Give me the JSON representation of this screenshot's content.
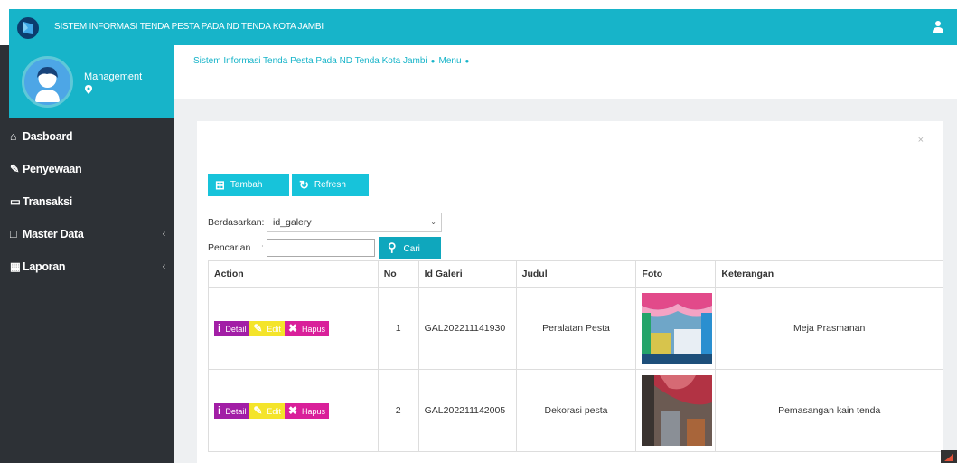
{
  "header": {
    "title": "SISTEM INFORMASI TENDA PESTA PADA ND TENDA KOTA JAMBI",
    "logo_icon": "logo-icon",
    "user_icon": "user-icon"
  },
  "profile": {
    "name": "Management"
  },
  "sidebar": {
    "items": [
      {
        "label": "Dasboard",
        "icon": "home-icon"
      },
      {
        "label": "Penyewaan",
        "icon": "pencil-icon"
      },
      {
        "label": "Transaksi",
        "icon": "book-icon"
      },
      {
        "label": "Master Data",
        "icon": "edit-icon",
        "has_children": true
      },
      {
        "label": "Laporan",
        "icon": "calendar-icon",
        "has_children": true
      }
    ]
  },
  "breadcrumb": {
    "path": "Sistem Informasi Tenda Pesta Pada ND Tenda Kota Jambi",
    "current": "Menu"
  },
  "toolbar": {
    "add_label": "Tambah",
    "refresh_label": "Refresh",
    "close_label": "×"
  },
  "filter": {
    "by_label": "Berdasarkan:",
    "by_value": "id_galery",
    "search_label": "Pencarian",
    "search_value": "",
    "search_button": "Cari"
  },
  "table": {
    "headers": [
      "Action",
      "No",
      "Id Galeri",
      "Judul",
      "Foto",
      "Keterangan"
    ],
    "action_labels": {
      "detail": "Detail",
      "edit": "Edit",
      "delete": "Hapus"
    },
    "rows": [
      {
        "no": "1",
        "id": "GAL202211141930",
        "judul": "Peralatan Pesta",
        "keterangan": "Meja Prasmanan"
      },
      {
        "no": "2",
        "id": "GAL202211142005",
        "judul": "Dekorasi pesta",
        "keterangan": "Pemasangan kain tenda"
      }
    ]
  },
  "colors": {
    "accent": "#17b4c9",
    "sidebar": "#2d3136",
    "detail": "#a21ea6",
    "edit": "#f4e42a",
    "delete": "#d9209a"
  }
}
